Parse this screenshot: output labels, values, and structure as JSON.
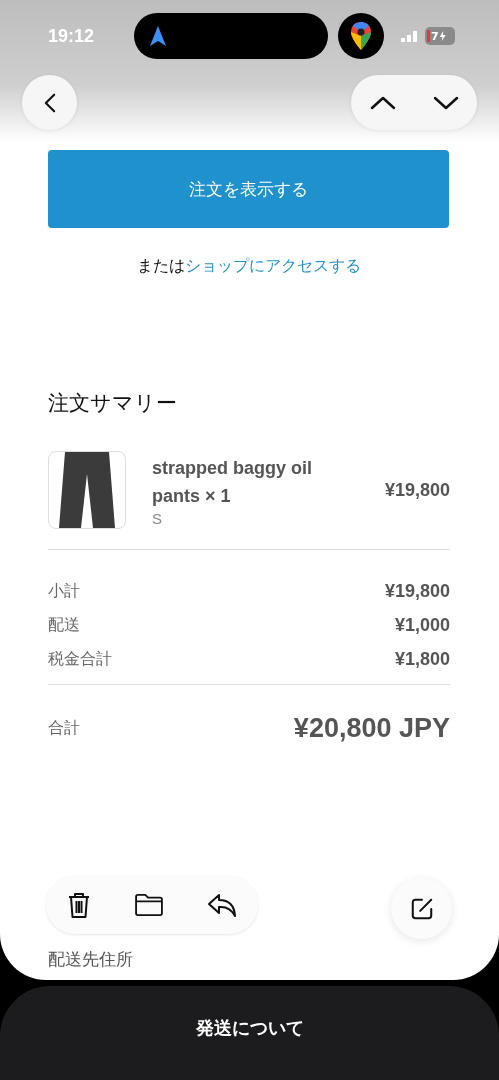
{
  "status_bar": {
    "time": "19:12",
    "battery_text": "7",
    "charging": true
  },
  "order_button": {
    "label": "注文を表示する"
  },
  "shop_link": {
    "prefix": "または",
    "link": "ショップにアクセスする"
  },
  "summary": {
    "title": "注文サマリー",
    "items": [
      {
        "name": "strapped baggy oil pants × 1",
        "variant": "S",
        "price": "¥19,800"
      }
    ],
    "lines": [
      {
        "label": "小計",
        "value": "¥19,800"
      },
      {
        "label": "配送",
        "value": "¥1,000"
      },
      {
        "label": "税金合計",
        "value": "¥1,800"
      }
    ],
    "total": {
      "label": "合計",
      "value": "¥20,800 JPY"
    }
  },
  "address_label": "配送先住所",
  "bottom_sheet": {
    "title": "発送について"
  }
}
